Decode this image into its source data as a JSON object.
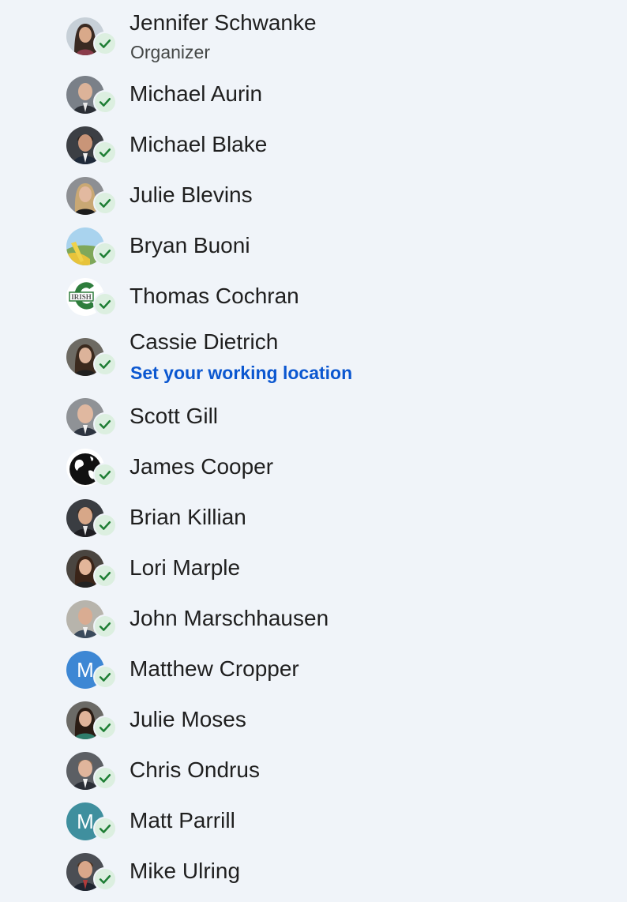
{
  "guests": [
    {
      "name": "Jennifer Schwanke",
      "subtext": "Organizer",
      "avatar": "photo",
      "status": "accepted"
    },
    {
      "name": "Michael Aurin",
      "avatar": "photo",
      "status": "accepted"
    },
    {
      "name": "Michael Blake",
      "avatar": "photo",
      "status": "accepted"
    },
    {
      "name": "Julie Blevins",
      "avatar": "photo",
      "status": "accepted"
    },
    {
      "name": "Bryan Buoni",
      "avatar": "landscape-photo",
      "status": "accepted"
    },
    {
      "name": "Thomas Cochran",
      "avatar": "school-logo",
      "logo_text": "IRISH",
      "status": "accepted"
    },
    {
      "name": "Cassie Dietrich",
      "link_text": "Set your working location",
      "avatar": "photo",
      "status": "accepted"
    },
    {
      "name": "Scott Gill",
      "avatar": "photo",
      "status": "accepted"
    },
    {
      "name": "James Cooper",
      "avatar": "globe-icon",
      "status": "accepted"
    },
    {
      "name": "Brian Killian",
      "avatar": "photo",
      "status": "accepted"
    },
    {
      "name": "Lori Marple",
      "avatar": "photo",
      "status": "accepted"
    },
    {
      "name": "John Marschhausen",
      "avatar": "photo",
      "status": "accepted"
    },
    {
      "name": "Matthew Cropper",
      "avatar": "initial",
      "initial": "M",
      "avatar_color": "#3d87d4",
      "status": "accepted"
    },
    {
      "name": "Julie Moses",
      "avatar": "photo",
      "status": "accepted"
    },
    {
      "name": "Chris Ondrus",
      "avatar": "photo",
      "status": "accepted"
    },
    {
      "name": "Matt Parrill",
      "avatar": "initial",
      "initial": "M",
      "avatar_color": "#3f8f9e",
      "status": "accepted"
    },
    {
      "name": "Mike Ulring",
      "avatar": "photo",
      "status": "accepted"
    }
  ],
  "colors": {
    "background": "#f0f4f9",
    "check": "#1e7e34",
    "check_badge": "#dcefe0",
    "link": "#0b57d0"
  }
}
